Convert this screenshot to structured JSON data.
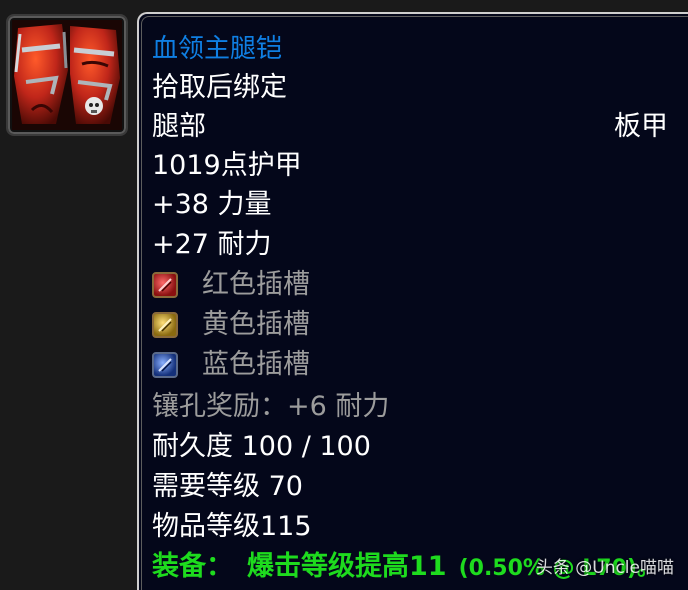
{
  "item": {
    "name": "血领主腿铠",
    "binding": "拾取后绑定",
    "slot": "腿部",
    "armor_type": "板甲",
    "armor": "1019点护甲",
    "stat1": "+38 力量",
    "stat2": "+27 耐力",
    "sockets": [
      {
        "label": "红色插槽",
        "color": "#c0202a",
        "icon": "red-socket-icon"
      },
      {
        "label": "黄色插槽",
        "color": "#c9a21a",
        "icon": "yellow-socket-icon"
      },
      {
        "label": "蓝色插槽",
        "color": "#2a5cc9",
        "icon": "blue-socket-icon"
      }
    ],
    "socket_bonus": "镶孔奖励：+6 耐力",
    "durability": "耐久度 100 / 100",
    "required_level": "需要等级 70",
    "item_level": "物品等级115",
    "equip_prefix": "装备：",
    "equip_text": "爆击等级提高11",
    "equip_extra": "(0.50% @ L70)。"
  },
  "icon": {
    "name": "blood-lord-legplates-icon",
    "colors": {
      "primary": "#c0261a",
      "dark": "#5a0d08",
      "highlight": "#ff6a3a",
      "metal": "#b0b6bc"
    }
  },
  "watermark": "头条 @Uncle喵喵",
  "colors": {
    "name": "#0f7fe3",
    "text": "#ffffff",
    "gray": "#9c9c9c",
    "equip": "#1edb1e",
    "background": "#04071a"
  }
}
